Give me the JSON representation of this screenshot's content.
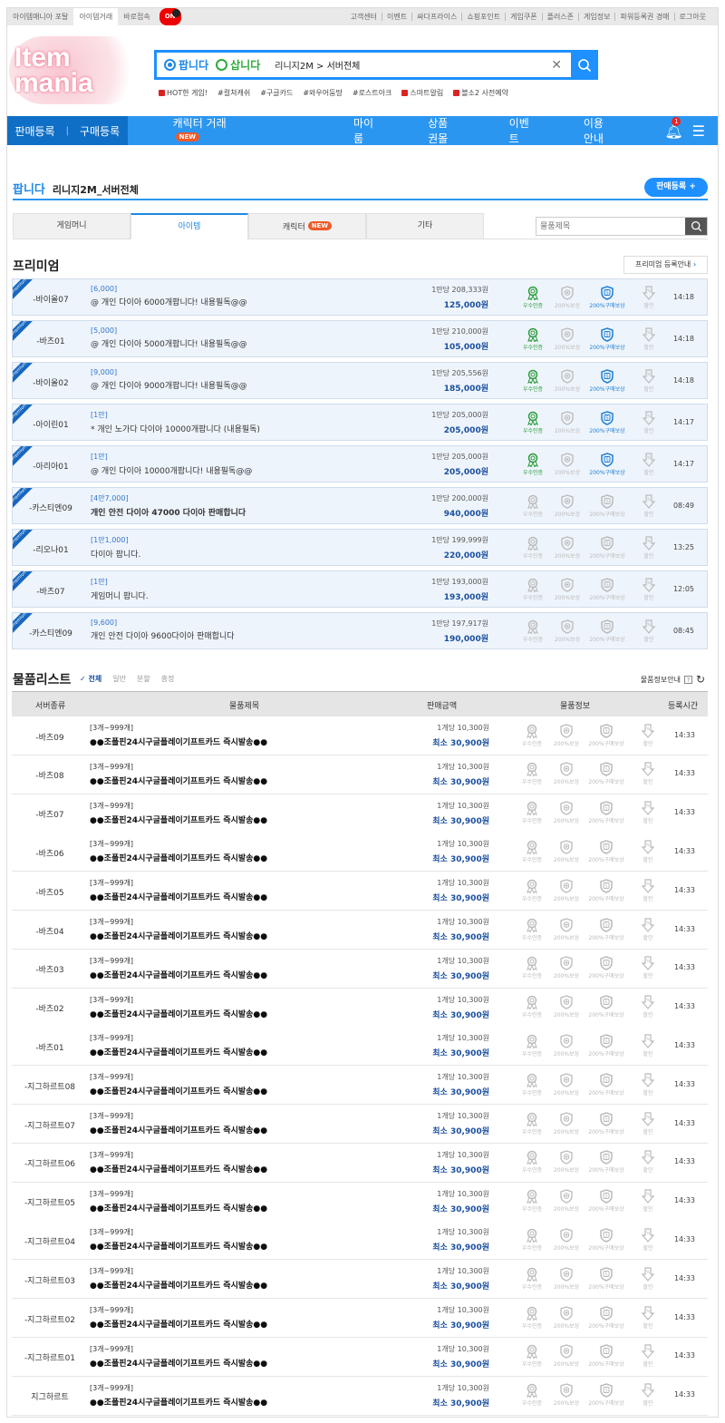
{
  "topbar": {
    "left": [
      "아이템매니아 포탈",
      "아이템거래",
      "바로접속"
    ],
    "toggle": "ON",
    "right": [
      "고객센터",
      "이벤트",
      "싸다프라이스",
      "쇼핑포인트",
      "게임쿠폰",
      "플러스존",
      "게임정보",
      "파워등록권 경매",
      "로그아웃"
    ]
  },
  "logo": {
    "text": "Item mania"
  },
  "search": {
    "sell": "팝니다",
    "buy": "삽니다",
    "query": "리니지2M > 서버전체"
  },
  "hot": [
    "HOT한 게임!",
    "#컬쳐캐쉬",
    "#구글카드",
    "#와우어둠땅",
    "#로스트아크",
    "스마트알림",
    "블소2 사전예약"
  ],
  "nav": {
    "sell_reg": "판매등록",
    "buy_reg": "구매등록",
    "items": [
      "캐릭터 거래",
      "마이룸",
      "상품권몰",
      "이벤트",
      "이용안내"
    ],
    "new": "NEW",
    "notif": "1"
  },
  "page": {
    "type": "팝니다",
    "game": "리니지2M_서버전체",
    "register": "판매등록 +"
  },
  "tabs": [
    "게임머니",
    "아이템",
    "캐릭터",
    "기타"
  ],
  "tab_search_placeholder": "물품제목",
  "premium": {
    "title": "프리미엄",
    "guide": "프리미엄 등록안내",
    "ribbon": "Premium"
  },
  "icon_labels": [
    "우수인증",
    "200%보상",
    "200%구매보상",
    "할인"
  ],
  "premium_rows": [
    {
      "server": "-바이올07",
      "qty": "[6,000]",
      "desc": "@ 개인 다이아 6000개팝니다! 내용필독@@",
      "unit": "1만당 208,333원",
      "total": "125,000원",
      "time": "14:18",
      "cert": true,
      "buy": true
    },
    {
      "server": "-바츠01",
      "qty": "[5,000]",
      "desc": "@ 개인 다이아 5000개팝니다! 내용필독@@",
      "unit": "1만당 210,000원",
      "total": "105,000원",
      "time": "14:18",
      "cert": true,
      "buy": true
    },
    {
      "server": "-바이올02",
      "qty": "[9,000]",
      "desc": "@ 개인 다이아 9000개팝니다! 내용필독@@",
      "unit": "1만당 205,556원",
      "total": "185,000원",
      "time": "14:18",
      "cert": true,
      "buy": true
    },
    {
      "server": "-아이린01",
      "qty": "[1만]",
      "desc": "* 개인 노가다 다이아 10000개팝니다 (내용필독)",
      "unit": "1만당 205,000원",
      "total": "205,000원",
      "time": "14:17",
      "cert": true,
      "buy": true
    },
    {
      "server": "-아리아01",
      "qty": "[1만]",
      "desc": "@ 개인 다이아 10000개팝니다! 내용필독@@",
      "unit": "1만당 205,000원",
      "total": "205,000원",
      "time": "14:17",
      "cert": true,
      "buy": true
    },
    {
      "server": "-카스티엔09",
      "qty": "[4만7,000]",
      "desc": "개인 안전 다이아 47000 다이아 판매합니다",
      "unit": "1만당 200,000원",
      "total": "940,000원",
      "time": "08:49",
      "bold": true
    },
    {
      "server": "-리오나01",
      "qty": "[1만1,000]",
      "desc": "다이아 팝니다.",
      "unit": "1만당 199,999원",
      "total": "220,000원",
      "time": "13:25"
    },
    {
      "server": "-바츠07",
      "qty": "[1만]",
      "desc": "게임머니 팝니다.",
      "unit": "1만당 193,000원",
      "total": "193,000원",
      "time": "12:05"
    },
    {
      "server": "-카스티엔09",
      "qty": "[9,600]",
      "desc": "개인 안전 다이아 9600다이아 판매합니다",
      "unit": "1만당 197,917원",
      "total": "190,000원",
      "time": "08:45"
    }
  ],
  "list": {
    "title": "물품리스트",
    "filters": [
      "✓ 전체",
      "일반",
      "분할",
      "흥정"
    ],
    "guide": "물품정보안내",
    "help": "?",
    "headers": [
      "서버종류",
      "물품제목",
      "판매금액",
      "물품정보",
      "등록시간"
    ]
  },
  "list_rows": [
    {
      "server": "-바츠09"
    },
    {
      "server": "-바츠08"
    },
    {
      "server": "-바츠07"
    },
    {
      "server": "-바츠06"
    },
    {
      "server": "-바츠05"
    },
    {
      "server": "-바츠04"
    },
    {
      "server": "-바츠03"
    },
    {
      "server": "-바츠02"
    },
    {
      "server": "-바츠01"
    },
    {
      "server": "-지그하르트08"
    },
    {
      "server": "-지그하르트07"
    },
    {
      "server": "-지그하르트06"
    },
    {
      "server": "-지그하르트05"
    },
    {
      "server": "-지그하르트04"
    },
    {
      "server": "-지그하르트03"
    },
    {
      "server": "-지그하르트02"
    },
    {
      "server": "-지그하르트01"
    },
    {
      "server": "지그하르트"
    }
  ],
  "list_common": {
    "qty": "[3개~999개]",
    "desc": "●●조폴핀24시구글플레이기프트카드 즉시발송●●",
    "unit": "1개당 10,300원",
    "total": "최소 30,900원",
    "time": "14:33"
  },
  "colors": {
    "primary": "#2b96f0",
    "nav_dark": "#0f6fc6",
    "green": "#2b9b3a",
    "red": "#e00000"
  }
}
